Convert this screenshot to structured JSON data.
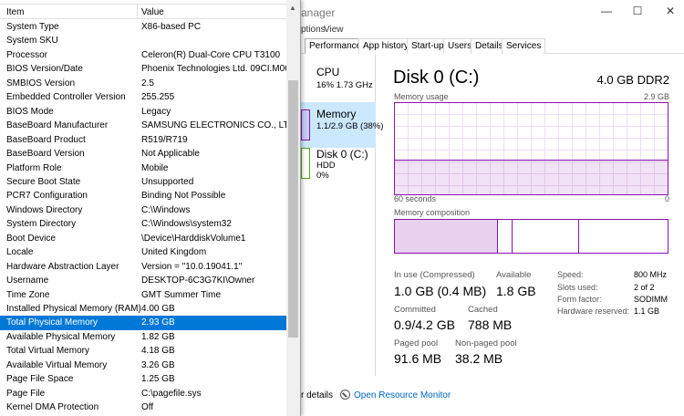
{
  "task_manager": {
    "title_fragment": "anager",
    "window_controls": {
      "minimize": "—",
      "maximize": "☐",
      "close": "✕"
    },
    "menu": [
      "ptions",
      "View"
    ],
    "tabs": [
      "Performance",
      "App history",
      "Start-up",
      "Users",
      "Details",
      "Services"
    ],
    "left_items": [
      {
        "label": "CPU",
        "sub": "16%  1.73 GHz",
        "selected": false
      },
      {
        "label": "Memory",
        "sub": "1.1/2.9 GB (38%)",
        "selected": true
      },
      {
        "label": "Disk 0 (C:)",
        "sub": "HDD",
        "sub2": "0%",
        "selected": false
      }
    ],
    "main": {
      "title": "Disk 0 (C:)",
      "capacity": "4.0 GB DDR2",
      "usage_label": "Memory usage",
      "usage_max": "2.9 GB",
      "time_left": "60 seconds",
      "time_right": "0",
      "composition_label": "Memory composition",
      "usage_fraction": 0.38,
      "stats": [
        {
          "label": "In use (Compressed)",
          "value": "1.0 GB (0.4 MB)"
        },
        {
          "label": "Available",
          "value": "1.8 GB"
        },
        {
          "label": "Committed",
          "value": "0.9/4.2 GB"
        },
        {
          "label": "Cached",
          "value": "788 MB"
        },
        {
          "label": "Paged pool",
          "value": "91.6 MB"
        },
        {
          "label": "Non-paged pool",
          "value": "38.2 MB"
        }
      ],
      "properties": [
        {
          "label": "Speed:",
          "value": "800 MHz"
        },
        {
          "label": "Slots used:",
          "value": "2 of 2"
        },
        {
          "label": "Form factor:",
          "value": "SODIMM"
        },
        {
          "label": "Hardware reserved:",
          "value": "1.1 GB"
        }
      ]
    },
    "bottom": {
      "fewer_details": "r details",
      "open_resource_monitor": "Open Resource Monitor"
    },
    "accent": "#8b12ae",
    "selected_bg": "#cce8ff"
  },
  "system_information": {
    "columns": {
      "item": "Item",
      "value": "Value"
    },
    "rows": [
      {
        "item": "System Type",
        "value": "X86-based PC"
      },
      {
        "item": "System SKU",
        "value": ""
      },
      {
        "item": "Processor",
        "value": "Celeron(R) Dual-Core CPU       T3100"
      },
      {
        "item": "BIOS Version/Date",
        "value": "Phoenix Technologies Ltd. 09CI.M060"
      },
      {
        "item": "SMBIOS Version",
        "value": "2.5"
      },
      {
        "item": "Embedded Controller Version",
        "value": "255.255"
      },
      {
        "item": "BIOS Mode",
        "value": "Legacy"
      },
      {
        "item": "BaseBoard Manufacturer",
        "value": "SAMSUNG ELECTRONICS CO., LTD."
      },
      {
        "item": "BaseBoard Product",
        "value": "R519/R719"
      },
      {
        "item": "BaseBoard Version",
        "value": "Not Applicable"
      },
      {
        "item": "Platform Role",
        "value": "Mobile"
      },
      {
        "item": "Secure Boot State",
        "value": "Unsupported"
      },
      {
        "item": "PCR7 Configuration",
        "value": "Binding Not Possible"
      },
      {
        "item": "Windows Directory",
        "value": "C:\\Windows"
      },
      {
        "item": "System Directory",
        "value": "C:\\Windows\\system32"
      },
      {
        "item": "Boot Device",
        "value": "\\Device\\HarddiskVolume1"
      },
      {
        "item": "Locale",
        "value": "United Kingdom"
      },
      {
        "item": "Hardware Abstraction Layer",
        "value": "Version = \"10.0.19041.1\""
      },
      {
        "item": "Username",
        "value": "DESKTOP-6C3G7KI\\Owner"
      },
      {
        "item": "Time Zone",
        "value": "GMT Summer Time"
      },
      {
        "item": "Installed Physical Memory (RAM)",
        "value": "4.00 GB"
      },
      {
        "item": "Total Physical Memory",
        "value": "2.93 GB",
        "selected": true
      },
      {
        "item": "Available Physical Memory",
        "value": "1.82 GB"
      },
      {
        "item": "Total Virtual Memory",
        "value": "4.18 GB"
      },
      {
        "item": "Available Virtual Memory",
        "value": "3.26 GB"
      },
      {
        "item": "Page File Space",
        "value": "1.25 GB"
      },
      {
        "item": "Page File",
        "value": "C:\\pagefile.sys"
      },
      {
        "item": "Kernel DMA Protection",
        "value": "Off"
      }
    ],
    "selection_color": "#0078d7"
  }
}
